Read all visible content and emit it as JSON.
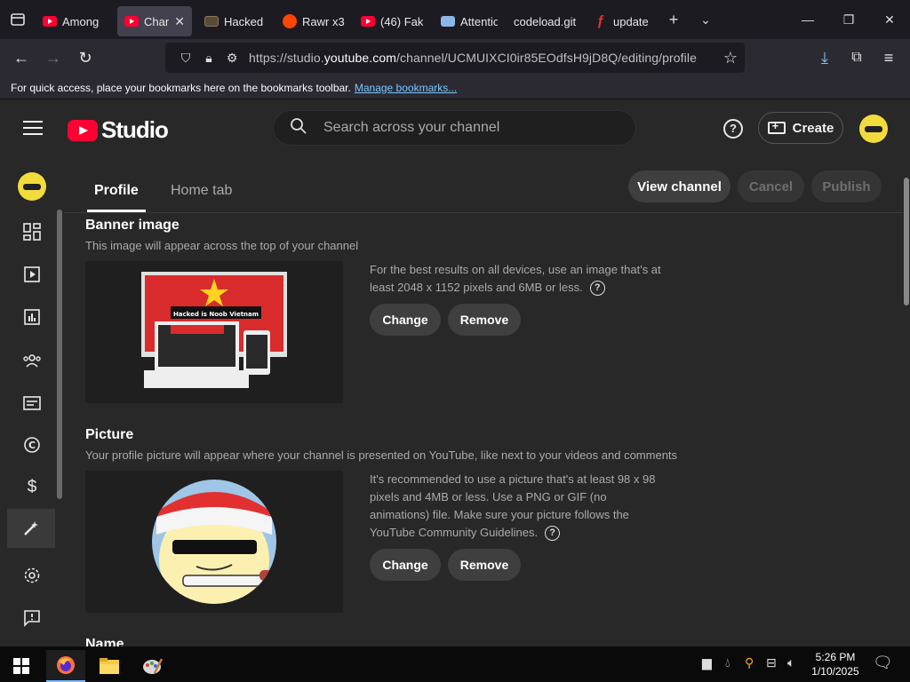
{
  "browser": {
    "tabs": [
      {
        "label": "Among",
        "icon": "youtube-icon",
        "fav": "yt"
      },
      {
        "label": "Chan",
        "icon": "youtube-icon",
        "fav": "yt",
        "active": true
      },
      {
        "label": "Hacked",
        "icon": "image-icon",
        "fav": "img"
      },
      {
        "label": "Rawr x3",
        "icon": "reddit-icon",
        "fav": "reddit"
      },
      {
        "label": "(46) Fak",
        "icon": "youtube-icon",
        "fav": "yt"
      },
      {
        "label": "Attentio",
        "icon": "lock-icon",
        "fav": "lock"
      },
      {
        "label": "codeload.git",
        "icon": "",
        "fav": "none"
      },
      {
        "label": "update",
        "icon": "page-icon",
        "fav": "red"
      }
    ],
    "url_prefix": "https://studio.",
    "url_host": "youtube.com",
    "url_path": "/channel/UCMUIXCI0ir85EOdfsH9jD8Q/editing/profile",
    "bookmarks_text": "For quick access, place your bookmarks here on the bookmarks toolbar.",
    "bookmarks_link": "Manage bookmarks..."
  },
  "studio": {
    "logo_text": "Studio",
    "search_placeholder": "Search across your channel",
    "create_label": "Create",
    "help_label": "?"
  },
  "profile": {
    "tabs": [
      "Profile",
      "Home tab"
    ],
    "view_channel": "View channel",
    "cancel": "Cancel",
    "publish": "Publish",
    "banner": {
      "title": "Banner image",
      "desc": "This image will appear across the top of your channel",
      "info": "For the best results on all devices, use an image that's at least 2048 x 1152 pixels and 6MB or less.",
      "change": "Change",
      "remove": "Remove",
      "banner_text": "Hacked is Noob Vietnam"
    },
    "picture": {
      "title": "Picture",
      "desc": "Your profile picture will appear where your channel is presented on YouTube, like next to your videos and comments",
      "info": "It's recommended to use a picture that's at least 98 x 98 pixels and 4MB or less. Use a PNG or GIF (no animations) file. Make sure your picture follows the YouTube Community Guidelines.",
      "change": "Change",
      "remove": "Remove"
    },
    "name_title": "Name"
  },
  "taskbar": {
    "time": "5:26 PM",
    "date": "1/10/2025"
  },
  "colors": {
    "accent_red": "#ff0033",
    "link_blue": "#7cc7ff"
  }
}
